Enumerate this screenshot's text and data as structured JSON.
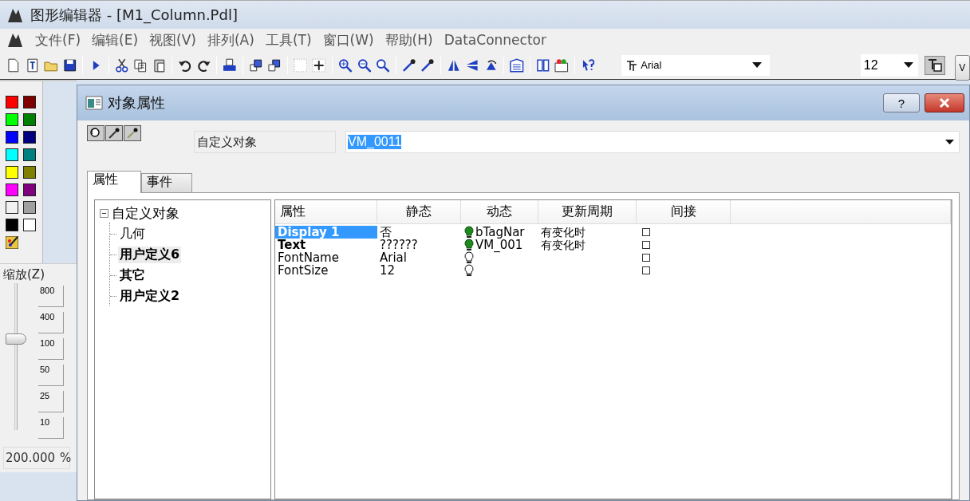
{
  "window": {
    "title": "图形编辑器 - [M1_Column.Pdl]"
  },
  "menu": [
    "文件(F)",
    "编辑(E)",
    "视图(V)",
    "排列(A)",
    "工具(T)",
    "窗口(W)",
    "帮助(H)",
    "DataConnector"
  ],
  "toolbar": {
    "font": "Arial",
    "font_size": "12",
    "button_v": "V"
  },
  "palette": {
    "colors": [
      {
        "color": "#ff0000"
      },
      {
        "color": "#800000"
      },
      {
        "color": "#00ff00"
      },
      {
        "color": "#008000"
      },
      {
        "color": "#0000ff"
      },
      {
        "color": "#000080"
      },
      {
        "color": "#00ffff"
      },
      {
        "color": "#008080"
      },
      {
        "color": "#ffff00"
      },
      {
        "color": "#808000"
      },
      {
        "color": "#ff00ff"
      },
      {
        "color": "#800080"
      },
      {
        "color": "#f0f0f0"
      },
      {
        "color": "#a0a0a0"
      },
      {
        "color": "#000000"
      },
      {
        "color": "#ffffff"
      }
    ]
  },
  "zoom": {
    "label": "缩放(Z)",
    "level": 0.63,
    "presets": [
      "800",
      "400",
      "100",
      "50",
      "25",
      "10"
    ],
    "value": "200.000",
    "unit": "%"
  },
  "dialog": {
    "title": "对象属性",
    "help": "?",
    "object_type": "自定义对象",
    "object_name": "VM_0011",
    "tabs": [
      {
        "label": "属性",
        "selected": true
      },
      {
        "label": "事件",
        "selected": false
      }
    ],
    "tree": {
      "label": "自定义对象",
      "expanded": true,
      "children": [
        {
          "label": "几何",
          "bold": false,
          "selected": false
        },
        {
          "label": "用户定义6",
          "bold": true,
          "selected": true
        },
        {
          "label": "其它",
          "bold": true,
          "selected": false
        },
        {
          "label": "用户定义2",
          "bold": true,
          "selected": false
        }
      ]
    },
    "table": {
      "columns": [
        "属性",
        "静态",
        "动态",
        "更新周期",
        "间接"
      ],
      "rows": [
        {
          "property": "Display 1",
          "static": "否",
          "dynamic": true,
          "tag": "bTagNar",
          "update": "有变化时",
          "indirect": false,
          "bold": true,
          "selected": true
        },
        {
          "property": "Text",
          "static": "??????",
          "dynamic": true,
          "tag": "VM_001",
          "update": "有变化时",
          "indirect": false,
          "bold": true,
          "selected": false
        },
        {
          "property": "FontName",
          "static": "Arial",
          "dynamic": false,
          "indirect": false,
          "bold": false,
          "selected": false
        },
        {
          "property": "FontSize",
          "static": "12",
          "dynamic": false,
          "indirect": false,
          "bold": false,
          "selected": false
        }
      ]
    }
  }
}
